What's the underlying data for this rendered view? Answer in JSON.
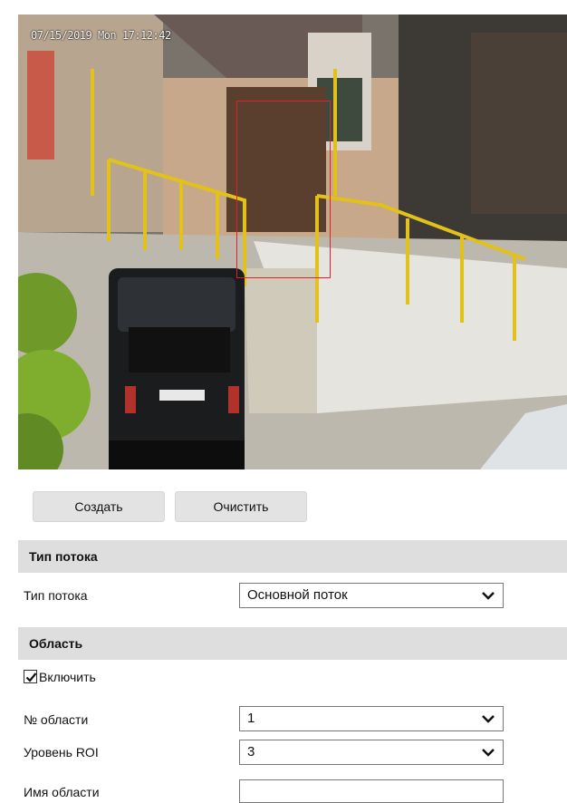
{
  "video": {
    "osd_timestamp": "07/15/2019 Mon 17:12:42"
  },
  "buttons": {
    "create": "Создать",
    "clear": "Очистить"
  },
  "stream_section": {
    "header": "Тип потока",
    "stream_type_label": "Тип потока",
    "stream_type_value": "Основной поток"
  },
  "area_section": {
    "header": "Область",
    "enable_label": "Включить",
    "enable_checked": true,
    "area_no_label": "№ области",
    "area_no_value": "1",
    "roi_level_label": "Уровень ROI",
    "roi_level_value": "3",
    "area_name_label": "Имя области",
    "area_name_value": ""
  },
  "colors": {
    "roi_rect": "#e0202a",
    "section_header_bg": "#dedede",
    "button_bg": "#e3e3e3"
  }
}
